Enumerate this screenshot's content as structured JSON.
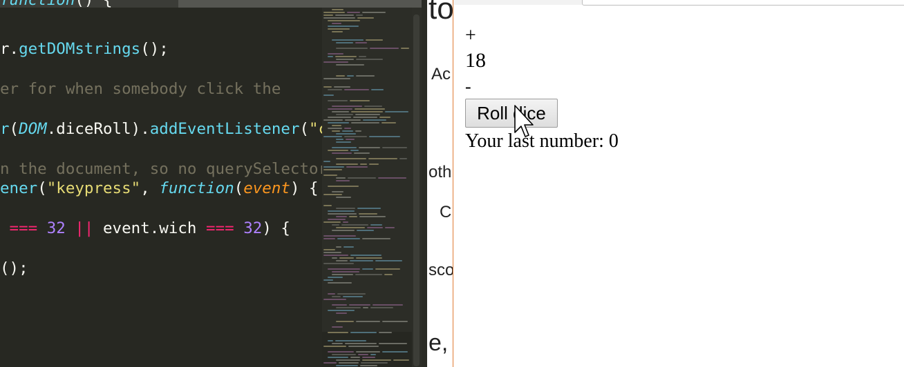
{
  "editor": {
    "code_lines": [
      [
        {
          "t": "italic",
          "v": "function"
        },
        {
          "t": "plain",
          "v": "() {"
        }
      ],
      [
        {
          "t": "plain",
          "v": "r."
        },
        {
          "t": "fn",
          "v": "getDOMstrings"
        },
        {
          "t": "plain",
          "v": "();"
        }
      ],
      [
        {
          "t": "comment",
          "v": "er for when somebody click the"
        }
      ],
      [
        {
          "t": "fn",
          "v": "r"
        },
        {
          "t": "plain",
          "v": "("
        },
        {
          "t": "italic",
          "v": "DOM"
        },
        {
          "t": "plain",
          "v": ".diceRoll)."
        },
        {
          "t": "fn",
          "v": "addEventListener"
        },
        {
          "t": "plain",
          "v": "("
        },
        {
          "t": "str",
          "v": "\"cl"
        }
      ],
      [
        {
          "t": "comment",
          "v": "n the document, so no querySelector"
        }
      ],
      [
        {
          "t": "fn",
          "v": "ener"
        },
        {
          "t": "plain",
          "v": "("
        },
        {
          "t": "str",
          "v": "\"keypress\""
        },
        {
          "t": "plain",
          "v": ", "
        },
        {
          "t": "italic",
          "v": "function"
        },
        {
          "t": "plain",
          "v": "("
        },
        {
          "t": "param",
          "v": "event"
        },
        {
          "t": "plain",
          "v": ") {"
        }
      ],
      [
        {
          "t": "op",
          "v": " === "
        },
        {
          "t": "num",
          "v": "32"
        },
        {
          "t": "plain",
          "v": " "
        },
        {
          "t": "op",
          "v": "||"
        },
        {
          "t": "plain",
          "v": " event.wich "
        },
        {
          "t": "op",
          "v": "==="
        },
        {
          "t": "plain",
          "v": " "
        },
        {
          "t": "num",
          "v": "32"
        },
        {
          "t": "plain",
          "v": ") {"
        }
      ],
      [
        {
          "t": "plain",
          "v": "();"
        }
      ]
    ],
    "token_colors": {
      "plain": "#f8f8f2",
      "fn": "#66d9ef",
      "italic": "#66d9ef",
      "str": "#e6db74",
      "op": "#f92672",
      "num": "#ae81ff",
      "param": "#fd971f",
      "comment": "#75715e"
    }
  },
  "background_document": {
    "fragments": [
      "to",
      "Ac",
      "oth",
      "C",
      "sco",
      "e,"
    ]
  },
  "browser": {
    "page": {
      "plus_label": "+",
      "score_value": "18",
      "minus_label": "-",
      "roll_button_label": "Roll dice",
      "last_number_text": "Your last number: 0"
    }
  },
  "icons": {
    "pointer": "arrow-cursor-icon"
  },
  "colors": {
    "editor_background": "#272822",
    "window_border_accent": "#e07b32",
    "button_border": "#9a9a9a"
  }
}
